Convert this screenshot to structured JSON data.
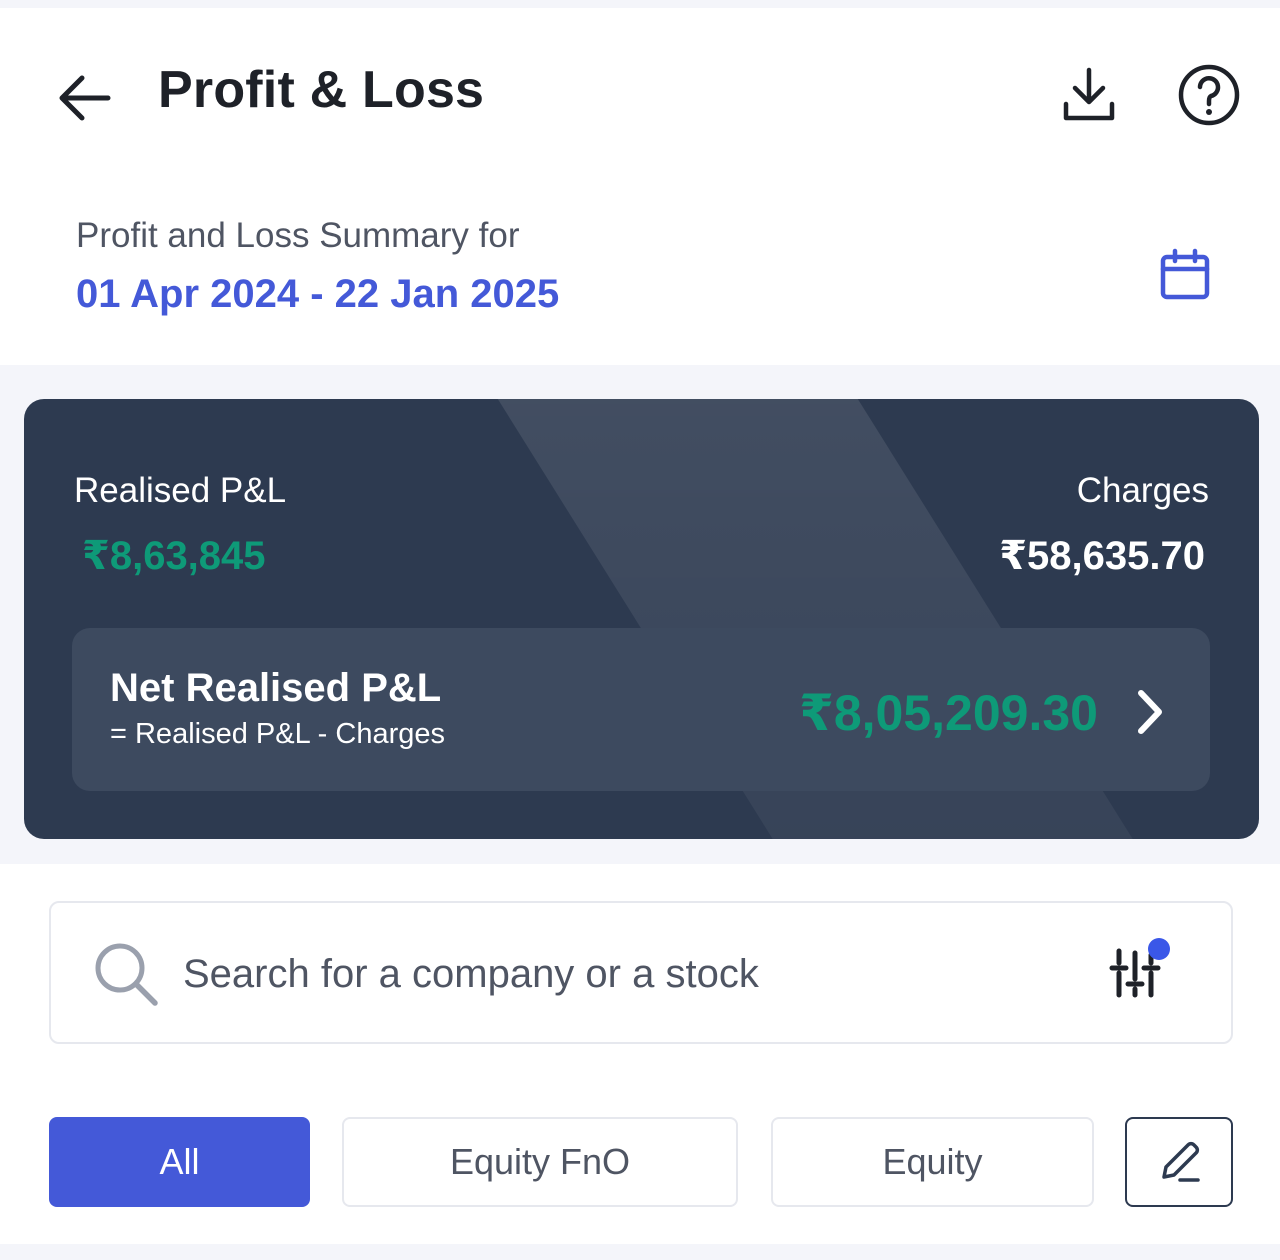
{
  "header": {
    "title": "Profit & Loss",
    "back_icon": "arrow-left-icon",
    "download_icon": "download-icon",
    "help_icon": "help-circle-icon"
  },
  "summary": {
    "label": "Profit and Loss Summary for",
    "date_range": "01 Apr 2024 - 22 Jan 2025",
    "calendar_icon": "calendar-icon"
  },
  "pnl_card": {
    "realised_label": "Realised P&L",
    "realised_value": "₹8,63,845",
    "charges_label": "Charges",
    "charges_value": "₹58,635.70",
    "net_title": "Net Realised P&L",
    "net_formula": "= Realised P&L - Charges",
    "net_value": "₹8,05,209.30"
  },
  "search": {
    "placeholder": "Search for a company or a stock",
    "value": ""
  },
  "filters": {
    "chips": [
      "All",
      "Equity FnO",
      "Equity"
    ],
    "selected": "All",
    "edit_icon": "pencil-icon"
  },
  "colors": {
    "accent": "#4459d8",
    "profit": "#0e9a78",
    "card_bg": "#2d3a50",
    "net_row_bg": "#3d4a5f",
    "filter_dot": "#3a57e8"
  }
}
